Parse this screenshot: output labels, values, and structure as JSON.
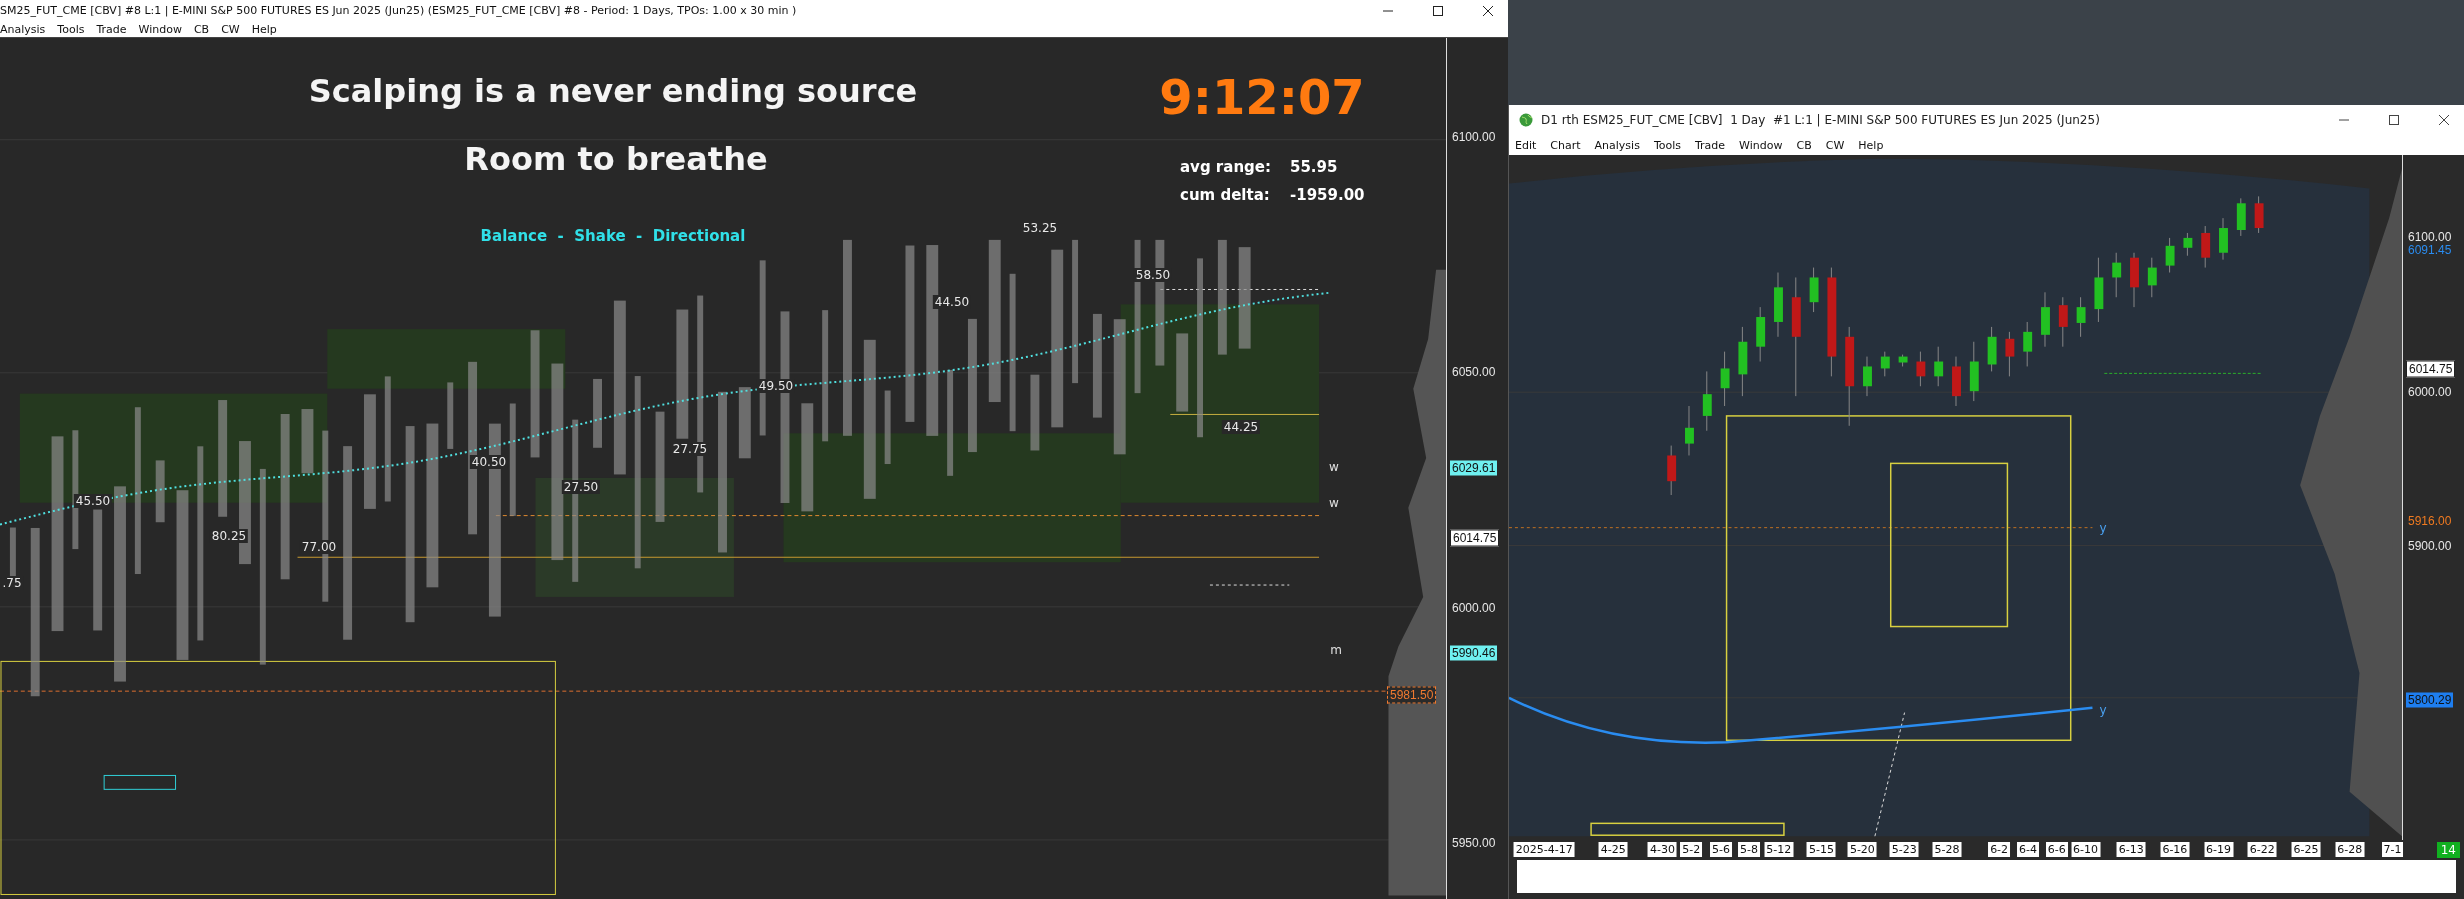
{
  "left_window": {
    "title": "SM25_FUT_CME [CBV] #8 L:1 | E-MINI S&P 500 FUTURES ES Jun 2025 (Jun25) (ESM25_FUT_CME [CBV] #8 - Period: 1 Days, TPOs: 1.00 x 30 min )",
    "menu": [
      "Analysis",
      "Tools",
      "Trade",
      "Window",
      "CB",
      "CW",
      "Help"
    ],
    "headline": "Scalping is a never ending source",
    "subheadline": "Room to breathe",
    "clock": "9:12:07",
    "stats": [
      {
        "label": "avg range:",
        "value": "55.95"
      },
      {
        "label": "cum delta:",
        "value": "-1959.00"
      }
    ],
    "phases": "Balance  -  Shake  -  Directional",
    "profile_labels": [
      "53.25",
      "58.50",
      "44.50",
      "49.50",
      "27.75",
      "27.50",
      "40.50",
      "45.50",
      "80.25",
      "77.00",
      "44.25",
      ".75"
    ],
    "level_markers": [
      "w",
      "w",
      "m"
    ],
    "price_axis": [
      {
        "text": "6100.00",
        "kind": "tick"
      },
      {
        "text": "6050.00",
        "kind": "tick"
      },
      {
        "text": "6029.61",
        "kind": "badge-cyan"
      },
      {
        "text": "6014.75",
        "kind": "badge-white"
      },
      {
        "text": "6000.00",
        "kind": "tick"
      },
      {
        "text": "5990.46",
        "kind": "badge-cyan"
      },
      {
        "text": "5981.50",
        "kind": "badge-orange"
      },
      {
        "text": "5950.00",
        "kind": "tick"
      }
    ]
  },
  "right_window": {
    "title": "D1 rth ESM25_FUT_CME [CBV]  1 Day  #1 L:1 | E-MINI S&P 500 FUTURES ES Jun 2025 (Jun25)",
    "menu": [
      "Edit",
      "Chart",
      "Analysis",
      "Tools",
      "Trade",
      "Window",
      "CB",
      "CW",
      "Help"
    ],
    "level_markers": [
      "y",
      "y"
    ],
    "price_axis": [
      {
        "text": "6100.00",
        "kind": "tick"
      },
      {
        "text": "6091.45",
        "kind": "text-blue"
      },
      {
        "text": "6014.75",
        "kind": "badge-white"
      },
      {
        "text": "6000.00",
        "kind": "tick"
      },
      {
        "text": "5916.00",
        "kind": "text-orange"
      },
      {
        "text": "5900.00",
        "kind": "tick"
      },
      {
        "text": "5800.29",
        "kind": "badge-blue"
      }
    ],
    "date_axis": [
      "2025-4-17",
      "4-25",
      "4-30",
      "5-2",
      "5-6",
      "5-8",
      "5-12",
      "5-15",
      "5-20",
      "5-23",
      "5-28",
      "6-2",
      "6-4",
      "6-6",
      "6-10",
      "6-13",
      "6-16",
      "6-19",
      "6-22",
      "6-25",
      "6-28",
      "7-1"
    ],
    "corner_badge": "14"
  }
}
